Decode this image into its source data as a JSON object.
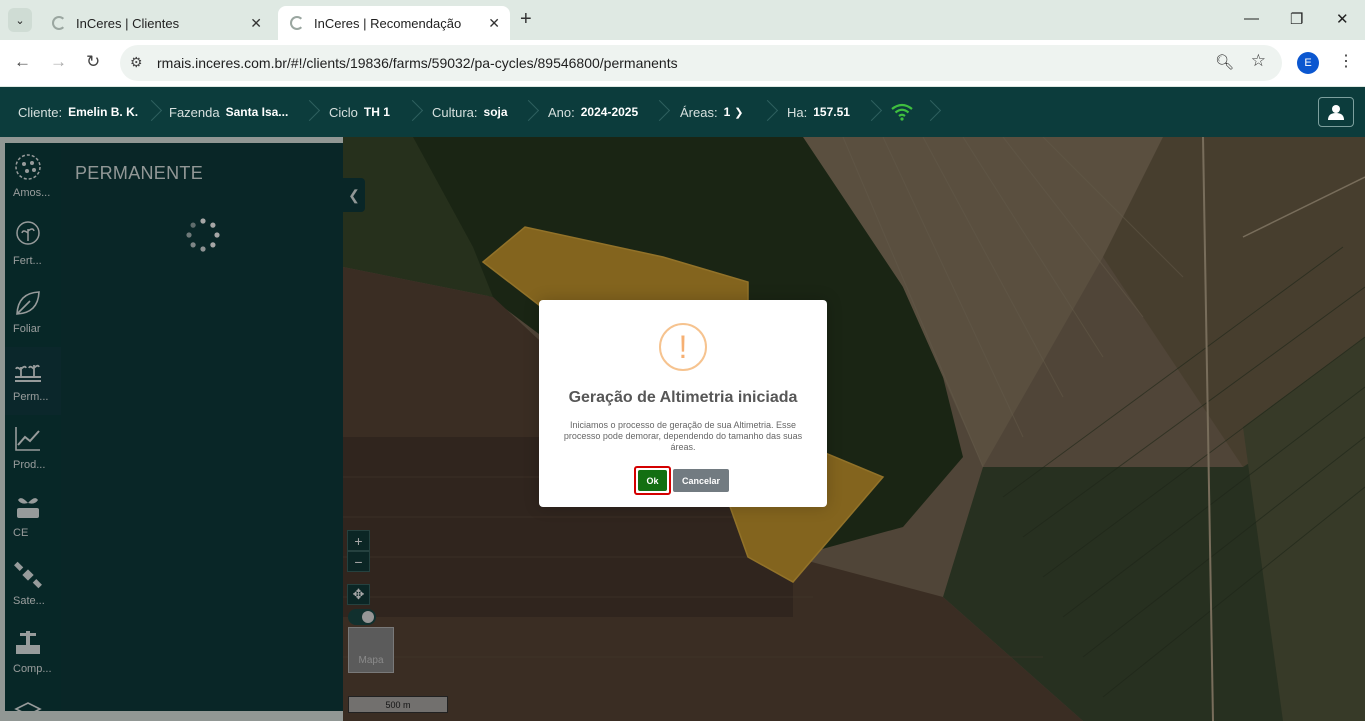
{
  "browser": {
    "tabs": [
      {
        "title": "InCeres | Clientes",
        "active": false
      },
      {
        "title": "InCeres | Recomendação",
        "active": true
      }
    ],
    "url": "rmais.inceres.com.br/#!/clients/19836/farms/59032/pa-cycles/89546800/permanents",
    "profile_initial": "E"
  },
  "header": {
    "cliente_label": "Cliente:",
    "cliente_value": "Emelin B. K.",
    "fazenda_label": "Fazenda",
    "fazenda_value": "Santa Isa...",
    "ciclo_label": "Ciclo",
    "ciclo_value": "TH 1",
    "cultura_label": "Cultura:",
    "cultura_value": "soja",
    "ano_label": "Ano:",
    "ano_value": "2024-2025",
    "areas_label": "Áreas:",
    "areas_value": "1",
    "ha_label": "Ha:",
    "ha_value": "157.51"
  },
  "tools": [
    {
      "label": "Amos...",
      "icon": "sampling-icon"
    },
    {
      "label": "Fert...",
      "icon": "fertility-icon"
    },
    {
      "label": "Foliar",
      "icon": "leaf-icon"
    },
    {
      "label": "Perm...",
      "icon": "permanent-crop-icon",
      "selected": true
    },
    {
      "label": "Prod...",
      "icon": "productivity-chart-icon"
    },
    {
      "label": "CE",
      "icon": "conductivity-icon"
    },
    {
      "label": "Sate...",
      "icon": "satellite-icon"
    },
    {
      "label": "Comp...",
      "icon": "compaction-icon"
    }
  ],
  "panel": {
    "title": "PERMANENTE"
  },
  "map": {
    "zoom_in": "+",
    "zoom_out": "−",
    "layer_label": "Mapa",
    "scale": "500 m"
  },
  "modal": {
    "icon": "!",
    "title": "Geração de Altimetria iniciada",
    "message": "Iniciamos o processo de geração de sua Altimetria. Esse processo pode demorar, dependendo do tamanho das suas áreas.",
    "ok_label": "Ok",
    "cancel_label": "Cancelar"
  },
  "colors": {
    "header_bg": "#0c3c3c",
    "ok_button": "#136f12",
    "field_highlight": "#c99a2e"
  }
}
